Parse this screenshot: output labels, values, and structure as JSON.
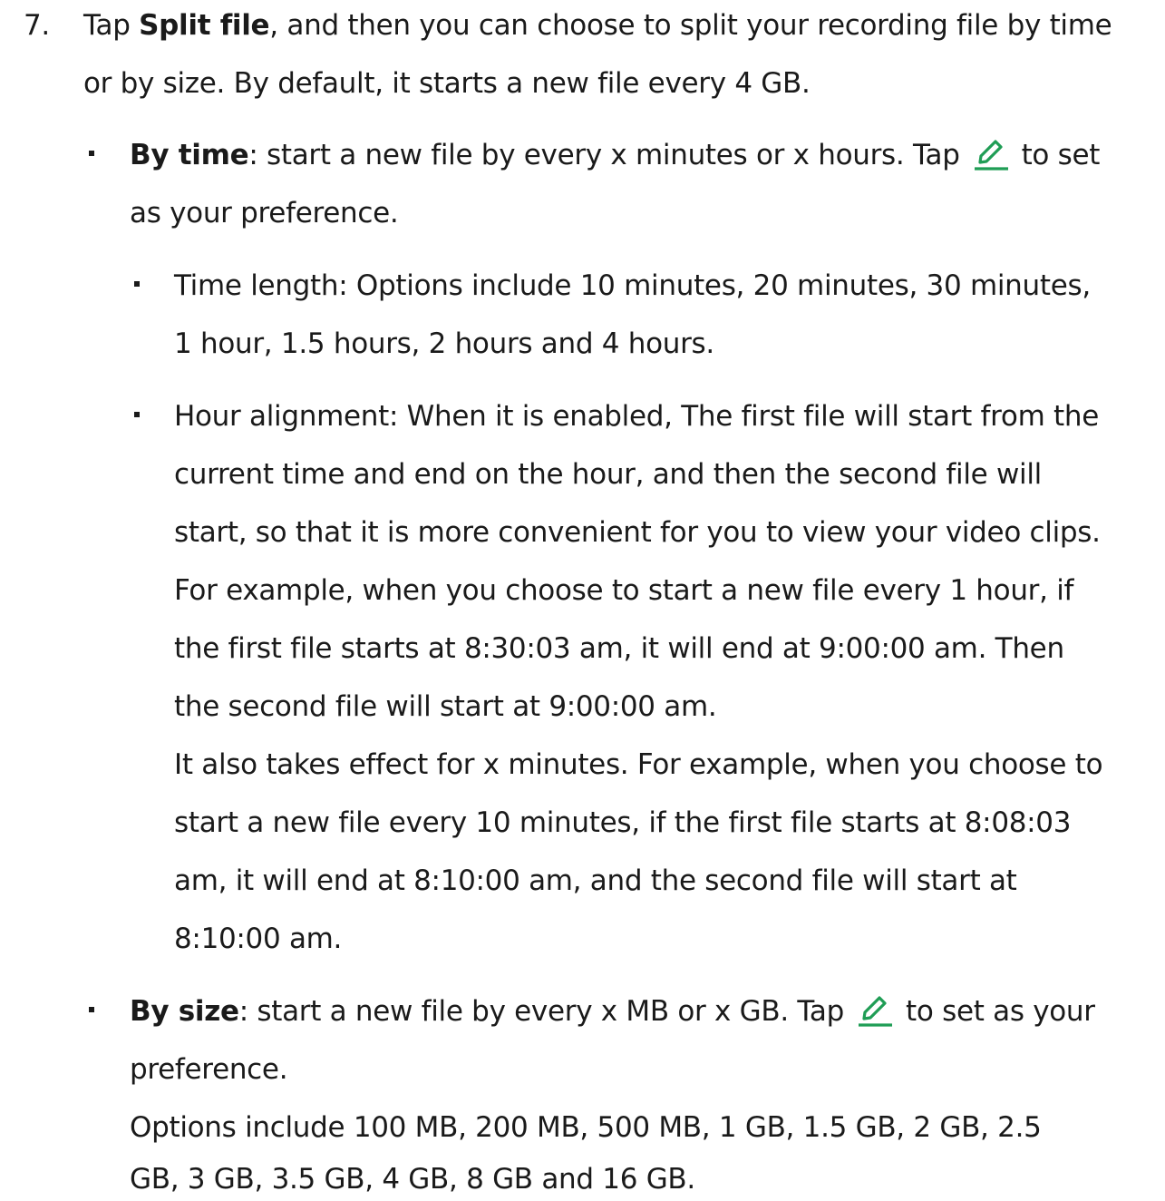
{
  "step": {
    "number": "7.",
    "tap": "Tap ",
    "bold": "Split file",
    "text_a": ", and then you can choose to split your recording file by time",
    "text_b": "or by size. By default, it starts a new file every 4 GB."
  },
  "by_time": {
    "bold": "By time",
    "text_a": ": start a new file by every x minutes or x hours. Tap",
    "text_after_icon": "to set",
    "text_b": "as your preference.",
    "icon": "edit-pencil-icon",
    "time_length": {
      "line1": "Time length: Options include 10 minutes, 20 minutes, 30 minutes,",
      "line2": "1 hour, 1.5 hours, 2 hours and 4 hours."
    },
    "hour_alignment": {
      "lines": [
        "Hour alignment: When it is enabled, The first file will start from the",
        "current time and end on the hour, and then the second file will",
        "start, so that it is more convenient for you to view your video clips.",
        "For example, when you choose to start a new file every 1 hour, if",
        "the first file starts at 8:30:03 am, it will end at 9:00:00 am. Then",
        "the second file will start at 9:00:00 am.",
        "It also takes effect for x minutes. For example, when you choose to",
        "start a new file every 10 minutes, if the first file starts at 8:08:03",
        "am, it will end at 8:10:00 am, and the second file will start at",
        "8:10:00 am."
      ]
    }
  },
  "by_size": {
    "bold": "By size",
    "text_a": ": start a new file by every x MB or x GB. Tap",
    "text_after_icon": "to set as your",
    "text_b": "preference.",
    "icon": "edit-pencil-icon",
    "options_lines": [
      "Options include 100 MB, 200 MB, 500 MB, 1 GB, 1.5 GB, 2 GB, 2.5",
      "GB, 3 GB, 3.5 GB, 4 GB, 8 GB and 16 GB."
    ]
  },
  "colors": {
    "text": "#1a1a1a",
    "icon_accent": "#1f9d55"
  }
}
